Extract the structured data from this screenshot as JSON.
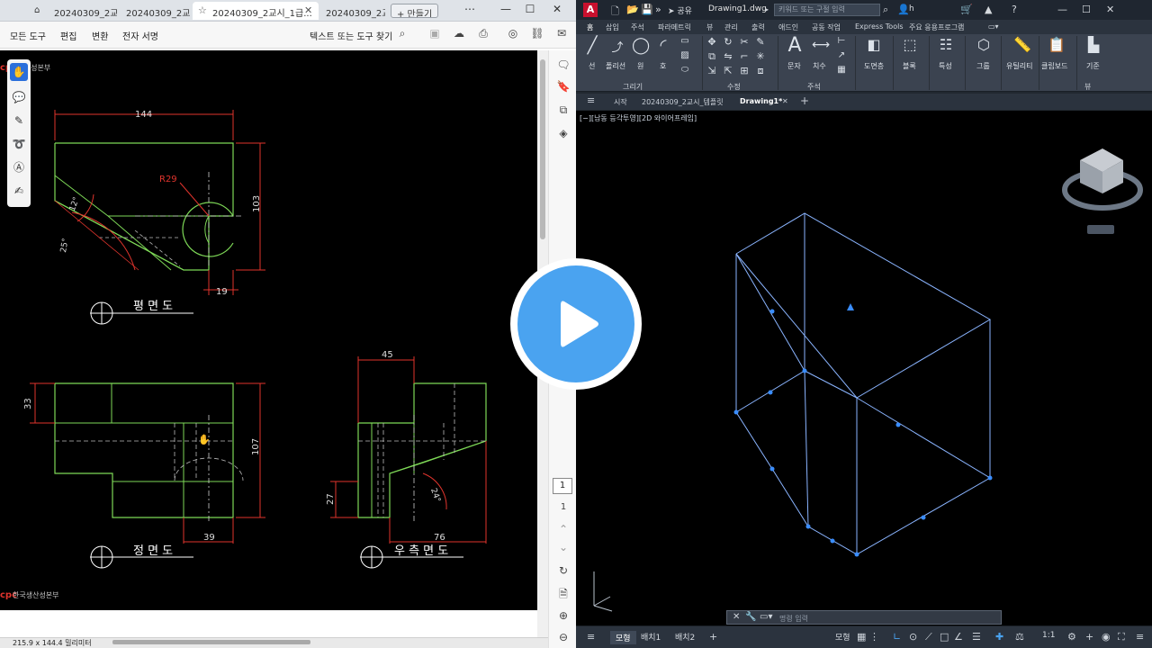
{
  "pdf": {
    "tabs": [
      {
        "label": "20240309_2교..."
      },
      {
        "label": "20240309_2교..."
      },
      {
        "label": "20240309_2교시_1급..."
      },
      {
        "label": "20240309_2교..."
      }
    ],
    "new_tab_label": "+ 만들기",
    "menu": {
      "all_tools": "모든 도구",
      "edit": "편집",
      "convert": "변환",
      "e_sign": "전자 서명",
      "find": "텍스트 또는 도구 찾기"
    },
    "page": {
      "logo_text_top": "국생산성본부",
      "logo_text_bottom": "한국생산성본부",
      "logo_mark": "cpc",
      "views": {
        "plan": "평 면 도",
        "front": "정 면 도",
        "right": "우 측 면 도"
      },
      "dims": {
        "plan_width": "144",
        "plan_radius": "R29",
        "plan_angle_a": "12°",
        "plan_angle_b": "25°",
        "plan_height": "103",
        "plan_offset": "19",
        "front_left": "33",
        "front_height": "107",
        "front_offset": "39",
        "right_top": "45",
        "right_left": "27",
        "right_angle": "24°",
        "right_width": "76"
      }
    },
    "page_current": "1",
    "page_total": "1",
    "status_dims": "215.9 x 144.4 밀리미터"
  },
  "cad": {
    "logo": "A",
    "share_label": "공유",
    "file_name": "Drawing1.dwg",
    "search_placeholder": "키워드 또는 구절 입력",
    "user": "h",
    "ribbon_tabs": [
      "홈",
      "삽입",
      "주석",
      "파라메트릭",
      "뷰",
      "관리",
      "출력",
      "애드인",
      "공동 작업",
      "Express Tools",
      "주요 응용프로그램"
    ],
    "ribbon": {
      "line": "선",
      "polyline": "폴리선",
      "circle": "원",
      "arc": "호",
      "draw_panel": "그리기",
      "modify_panel": "수정",
      "text": "문자",
      "dimension": "치수",
      "annotation_panel": "주석",
      "layers": "도면층",
      "block": "블록",
      "properties": "특성",
      "group": "그룹",
      "utilities": "유틸리티",
      "clipboard": "클립보드",
      "base": "기준",
      "view_panel": "뷰"
    },
    "doc_tabs": [
      "시작",
      "20240309_2교시_템플릿",
      "Drawing1*"
    ],
    "viewport_label": "[−][남동 등각투영][2D 와이어프레임]",
    "command_placeholder": "명령 입력",
    "layout_tabs": [
      "모형",
      "배치1",
      "배치2"
    ],
    "status_model": "모형",
    "status_scale": "1:1"
  },
  "colors": {
    "pdf_bg": "#000000",
    "dim_red": "#e0342d",
    "line_green": "#7ed957",
    "cad_wire": "#8ab4ff",
    "play_blue": "#4aa3f0"
  }
}
